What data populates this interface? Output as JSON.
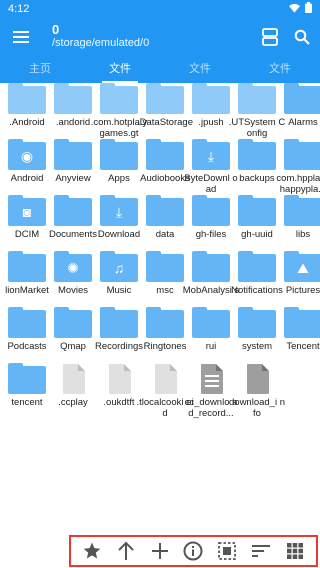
{
  "status": {
    "time": "4:12"
  },
  "header": {
    "count": "0",
    "path": "/storage/emulated/0",
    "icons": [
      "menu-icon",
      "storage-icon",
      "search-icon"
    ]
  },
  "tabs": [
    {
      "label": "主页",
      "active": false
    },
    {
      "label": "文件",
      "active": true
    },
    {
      "label": "文件",
      "active": false
    },
    {
      "label": "文件",
      "active": false
    }
  ],
  "items": [
    {
      "label": ".Android",
      "kind": "folder-light"
    },
    {
      "label": ".andorid",
      "kind": "folder-light"
    },
    {
      "label": ".com.hotpla ygames.gt",
      "kind": "folder-light"
    },
    {
      "label": ".DataStorage",
      "kind": "folder-light"
    },
    {
      "label": ".jpush",
      "kind": "folder-light"
    },
    {
      "label": ".UTSystem Config",
      "kind": "folder-light"
    },
    {
      "label": "Alarms",
      "kind": "folder"
    },
    {
      "label": "Android",
      "kind": "folder",
      "glyph": "android-icon"
    },
    {
      "label": "Anyview",
      "kind": "folder"
    },
    {
      "label": "Apps",
      "kind": "folder"
    },
    {
      "label": "Audiobooks",
      "kind": "folder"
    },
    {
      "label": "ByteDownl oad",
      "kind": "folder",
      "glyph": "download-icon"
    },
    {
      "label": "backups",
      "kind": "folder"
    },
    {
      "label": "com.hppla y.happypla...",
      "kind": "folder"
    },
    {
      "label": "DCIM",
      "kind": "folder",
      "glyph": "camera-icon"
    },
    {
      "label": "Documents",
      "kind": "folder"
    },
    {
      "label": "Download",
      "kind": "folder",
      "glyph": "download-icon"
    },
    {
      "label": "data",
      "kind": "folder"
    },
    {
      "label": "gh-files",
      "kind": "folder"
    },
    {
      "label": "gh-uuid",
      "kind": "folder"
    },
    {
      "label": "libs",
      "kind": "folder"
    },
    {
      "label": "lionMarket",
      "kind": "folder"
    },
    {
      "label": "Movies",
      "kind": "folder",
      "glyph": "film-icon"
    },
    {
      "label": "Music",
      "kind": "folder",
      "glyph": "music-icon"
    },
    {
      "label": "msc",
      "kind": "folder"
    },
    {
      "label": "MobAnalysi s",
      "kind": "folder"
    },
    {
      "label": "Notifications",
      "kind": "folder"
    },
    {
      "label": "Pictures",
      "kind": "folder",
      "glyph": "image-icon"
    },
    {
      "label": "Podcasts",
      "kind": "folder"
    },
    {
      "label": "Qmap",
      "kind": "folder"
    },
    {
      "label": "Recordings",
      "kind": "folder"
    },
    {
      "label": "Ringtones",
      "kind": "folder"
    },
    {
      "label": "rui",
      "kind": "folder"
    },
    {
      "label": "system",
      "kind": "folder"
    },
    {
      "label": "Tencent",
      "kind": "folder"
    },
    {
      "label": "tencent",
      "kind": "folder"
    },
    {
      "label": ".ccplay",
      "kind": "file"
    },
    {
      "label": ".oukdtft",
      "kind": "file"
    },
    {
      "label": ".tlocalcooki eid",
      "kind": "file"
    },
    {
      "label": "cc_downlo ad_record...",
      "kind": "file-doc"
    },
    {
      "label": "download_i nfo",
      "kind": "file-dark"
    }
  ],
  "toolbar": {
    "tools": [
      "star-icon",
      "arrow-up-icon",
      "plus-icon",
      "info-icon",
      "select-all-icon",
      "sort-icon",
      "grid-view-icon"
    ]
  },
  "colors": {
    "primary": "#2196F3",
    "folder": "#64B5F6",
    "folder_light": "#90CAF9",
    "highlight_border": "#e53935"
  }
}
